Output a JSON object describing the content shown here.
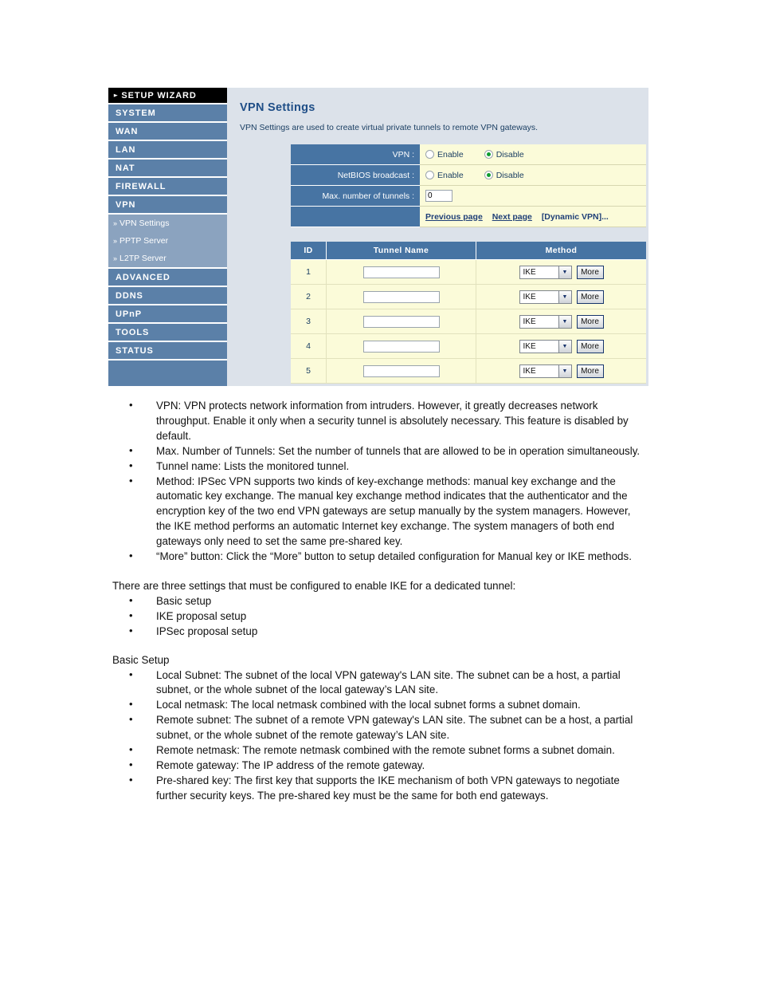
{
  "sidebar": {
    "wizard": {
      "label": "SETUP WIZARD",
      "caret": "chevron-right-icon"
    },
    "items": [
      {
        "label": "SYSTEM"
      },
      {
        "label": "WAN"
      },
      {
        "label": "LAN"
      },
      {
        "label": "NAT"
      },
      {
        "label": "FIREWALL"
      },
      {
        "label": "VPN"
      },
      {
        "label": "ADVANCED"
      },
      {
        "label": "DDNS"
      },
      {
        "label": "UPnP"
      },
      {
        "label": "TOOLS"
      },
      {
        "label": "STATUS"
      }
    ],
    "sub_items": [
      {
        "label": "VPN Settings",
        "marker": "»"
      },
      {
        "label": "PPTP Server",
        "marker": "»"
      },
      {
        "label": "L2TP Server",
        "marker": "»"
      }
    ]
  },
  "content": {
    "title": "VPN Settings",
    "description": "VPN Settings are used to create virtual private tunnels to remote VPN gateways.",
    "settings": [
      {
        "label": "VPN :",
        "type": "radio",
        "options": [
          "Enable",
          "Disable"
        ],
        "selected": "Disable"
      },
      {
        "label": "NetBIOS broadcast :",
        "type": "radio",
        "options": [
          "Enable",
          "Disable"
        ],
        "selected": "Disable"
      },
      {
        "label": "Max. number of tunnels :",
        "type": "text",
        "value": "0"
      }
    ],
    "links": [
      {
        "label": "Previous page",
        "style": "underline"
      },
      {
        "label": "Next page",
        "style": "underline"
      },
      {
        "label": "[Dynamic VPN]...",
        "style": "plain"
      }
    ],
    "tunnel_table": {
      "headers": [
        "ID",
        "Tunnel Name",
        "Method"
      ],
      "rows": [
        {
          "id": "1",
          "name": "",
          "method": "IKE",
          "button": "More"
        },
        {
          "id": "2",
          "name": "",
          "method": "IKE",
          "button": "More"
        },
        {
          "id": "3",
          "name": "",
          "method": "IKE",
          "button": "More"
        },
        {
          "id": "4",
          "name": "",
          "method": "IKE",
          "button": "More"
        },
        {
          "id": "5",
          "name": "",
          "method": "IKE",
          "button": "More"
        }
      ]
    }
  },
  "prose": {
    "bullets_main": [
      "VPN: VPN protects network information from intruders. However, it greatly decreases network throughput. Enable it only when a security tunnel is absolutely necessary. This feature is disabled by default.",
      "Max. Number of Tunnels: Set the number of tunnels that are allowed to be in operation simultaneously.",
      "Tunnel name: Lists the monitored tunnel.",
      "Method: IPSec VPN supports two kinds of key-exchange methods: manual key exchange and the automatic key exchange. The manual key exchange method indicates that the authenticator and the encryption key of the two end VPN gateways are setup manually by the system managers. However, the IKE method performs an automatic Internet key exchange. The system managers of both end gateways only need to set the same pre-shared key.",
      "“More” button: Click the “More” button to setup detailed configuration for Manual key or IKE methods."
    ],
    "intro_ike": "There are three settings that must be configured to enable IKE for a dedicated tunnel:",
    "bullets_ike": [
      "Basic setup",
      "IKE proposal setup",
      "IPSec proposal setup"
    ],
    "basic_setup_heading": "Basic Setup",
    "bullets_basic": [
      "Local Subnet: The subnet of the local VPN gateway's LAN site. The subnet can be a host, a partial subnet, or the whole subnet of the local gateway’s LAN site.",
      "Local netmask: The local netmask combined with the local subnet forms a subnet domain.",
      "Remote subnet: The subnet of a remote VPN gateway's LAN site. The subnet can be a host, a partial subnet, or the whole subnet of the remote gateway’s LAN site.",
      "Remote netmask: The remote netmask combined with the remote subnet forms a subnet domain.",
      "Remote gateway: The IP address of the remote gateway.",
      "Pre-shared key: The first key that supports the IKE mechanism of both VPN gateways to negotiate further security keys. The pre-shared key must be the same for both end gateways."
    ]
  },
  "colors": {
    "nav_blue": "#5b80a8",
    "nav_sub_blue": "#8ba3bf",
    "panel_bg": "#dce2ea",
    "table_header_blue": "#4774a3",
    "row_yellow": "#fbfbd9",
    "title_blue": "#1f4e87",
    "link_blue": "#1f3f77",
    "radio_green": "#0f9d2f"
  }
}
